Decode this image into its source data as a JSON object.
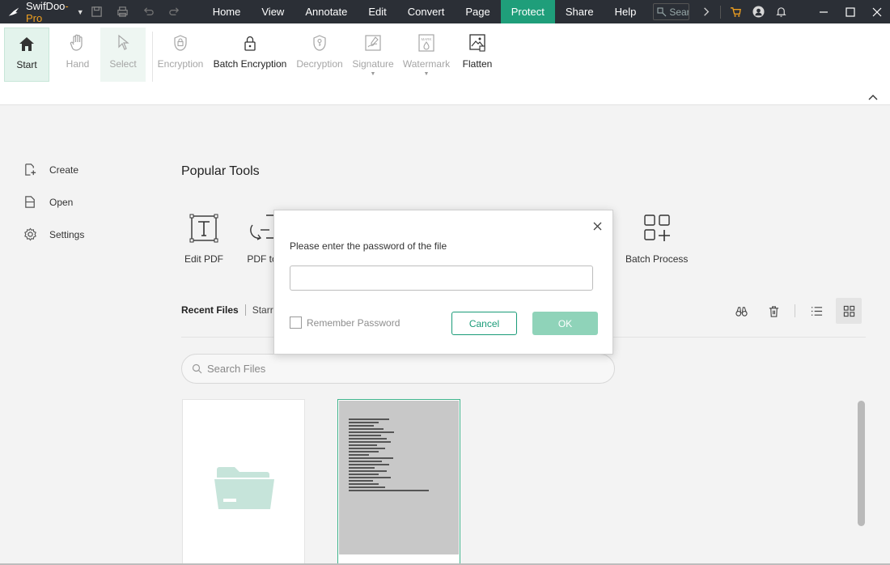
{
  "app": {
    "name": "SwifDoo",
    "edition": "-Pro"
  },
  "menu": [
    {
      "label": "Home",
      "active": false
    },
    {
      "label": "View",
      "active": false
    },
    {
      "label": "Annotate",
      "active": false
    },
    {
      "label": "Edit",
      "active": false
    },
    {
      "label": "Convert",
      "active": false
    },
    {
      "label": "Page",
      "active": false
    },
    {
      "label": "Protect",
      "active": true
    },
    {
      "label": "Share",
      "active": false
    },
    {
      "label": "Help",
      "active": false
    }
  ],
  "titlebar_search": {
    "placeholder": "Search"
  },
  "ribbon": {
    "start": "Start",
    "hand": "Hand",
    "select": "Select",
    "encryption": "Encryption",
    "batch_encryption": "Batch Encryption",
    "decryption": "Decryption",
    "signature": "Signature",
    "watermark": "Watermark",
    "flatten": "Flatten"
  },
  "sidebar": {
    "create": "Create",
    "open": "Open",
    "settings": "Settings"
  },
  "popular_tools": {
    "title": "Popular Tools",
    "edit_pdf": "Edit PDF",
    "pdf_to": "PDF to",
    "batch_process": "Batch Process"
  },
  "recent": {
    "tab_recent": "Recent Files",
    "tab_starred": "Starre"
  },
  "search_files": {
    "placeholder": "Search Files"
  },
  "dialog": {
    "message": "Please enter the password of the file",
    "password_value": "",
    "remember_label": "Remember Password",
    "remember_checked": false,
    "cancel": "Cancel",
    "ok": "OK"
  },
  "colors": {
    "accent": "#1f9e7a",
    "titlebar": "#2b2f36",
    "ok_button": "#8fd3b9"
  }
}
